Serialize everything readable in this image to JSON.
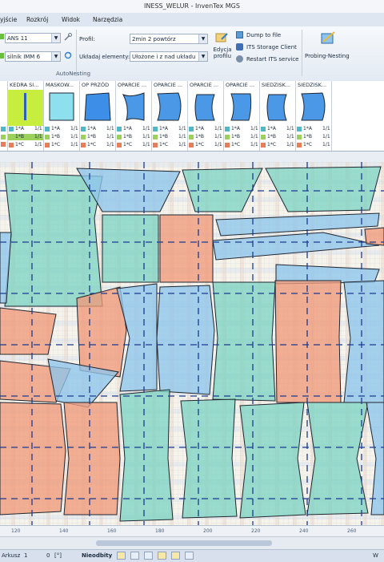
{
  "window": {
    "title": "INESS_WELUR - InvenTex MGS"
  },
  "menu": {
    "items": [
      "yjście",
      "Rozkrój",
      "Widok",
      "Narzędzia"
    ]
  },
  "ribbon": {
    "model_combo": "ANS 11",
    "variant_combo": "silnik IMM 6",
    "profile_label": "Profil:",
    "profile_value": "2min 2 powtórz",
    "layout_label": "Układaj elementy:",
    "layout_value": "Ułożone i z nad układu",
    "edit_profile_label": "Edycja profilu",
    "dump_label": "Dump to file",
    "its_client_label": "ITS Storage Client",
    "restart_label": "Restart ITS service",
    "probing_label": "Probing-Nesting",
    "group_name": "AutoNesting"
  },
  "tiles": [
    {
      "header": "KEDRA SI...",
      "kind": "stripe",
      "rows": [
        "1*A",
        "1*B",
        "1*C"
      ],
      "qty": [
        "1/1",
        "1/1",
        "1/1"
      ],
      "selected": true
    },
    {
      "header": "MASKOW...",
      "kind": "square",
      "rows": [
        "1*A",
        "1*B",
        "1*C"
      ],
      "qty": [
        "1/1",
        "1/1",
        "1/1"
      ],
      "selected": false
    },
    {
      "header": "OP PRZÓD",
      "kind": "trap",
      "rows": [
        "1*A",
        "1*B",
        "1*C"
      ],
      "qty": [
        "1/1",
        "1/1",
        "1/1"
      ],
      "selected": false
    },
    {
      "header": "OPARCIE ...",
      "kind": "curveR",
      "rows": [
        "1*A",
        "1*B",
        "1*C"
      ],
      "qty": [
        "1/1",
        "1/1",
        "1/1"
      ],
      "selected": false
    },
    {
      "header": "OPARCIE ...",
      "kind": "curveB",
      "rows": [
        "1*A",
        "1*B",
        "1*C"
      ],
      "qty": [
        "1/1",
        "1/1",
        "1/1"
      ],
      "selected": false
    },
    {
      "header": "OPARCIE ...",
      "kind": "curveS",
      "rows": [
        "1*A",
        "1*B",
        "1*C"
      ],
      "qty": [
        "1/1",
        "1/1",
        "1/1"
      ],
      "selected": false
    },
    {
      "header": "OPARCIE ...",
      "kind": "curveT",
      "rows": [
        "1*A",
        "1*B",
        "1*C"
      ],
      "qty": [
        "1/1",
        "1/1",
        "1/1"
      ],
      "selected": false
    },
    {
      "header": "SIEDZISK...",
      "kind": "curveS",
      "rows": [
        "1*A",
        "1*B",
        "1*C"
      ],
      "qty": [
        "1/1",
        "1/1",
        "1/1"
      ],
      "selected": false
    },
    {
      "header": "SIEDZISK...",
      "kind": "curveB",
      "rows": [
        "1*A",
        "1*B",
        "1*C"
      ],
      "qty": [
        "1/1",
        "1/1",
        "1/1"
      ],
      "selected": false
    }
  ],
  "first_col_qty": [
    "1/1",
    "1/1",
    "1/1"
  ],
  "colors": {
    "row_a": "#4fb7c9",
    "row_b": "#9bd05a",
    "row_c": "#e87d5a",
    "piece_teal": "#7fd3c3",
    "piece_salmon": "#f09a7a",
    "piece_blue": "#8ec5ec",
    "accent": "#2f7fd6"
  },
  "ruler": {
    "ticks": [
      "120",
      "140",
      "160",
      "180",
      "200",
      "220",
      "240",
      "260"
    ]
  },
  "status": {
    "left_label": "Arkusz",
    "left_value": "1",
    "angle": "0",
    "angle_unit": "[°]",
    "mode": "Nieodbity",
    "right": "W"
  }
}
